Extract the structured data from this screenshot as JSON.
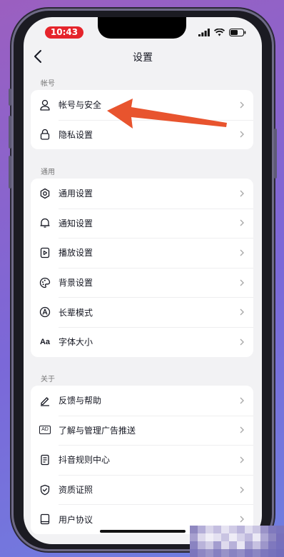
{
  "status_bar": {
    "time": "10:43"
  },
  "nav": {
    "title": "设置"
  },
  "sections": [
    {
      "header": "帐号",
      "items": [
        {
          "label": "帐号与安全",
          "icon": "person-icon"
        },
        {
          "label": "隐私设置",
          "icon": "lock-icon"
        }
      ]
    },
    {
      "header": "通用",
      "items": [
        {
          "label": "通用设置",
          "icon": "gear-icon"
        },
        {
          "label": "通知设置",
          "icon": "bell-icon"
        },
        {
          "label": "播放设置",
          "icon": "play-icon"
        },
        {
          "label": "背景设置",
          "icon": "palette-icon"
        },
        {
          "label": "长辈模式",
          "icon": "elder-mode-icon"
        },
        {
          "label": "字体大小",
          "icon": "font-size-icon",
          "icon_text": "Aa"
        }
      ]
    },
    {
      "header": "关于",
      "items": [
        {
          "label": "反馈与帮助",
          "icon": "pencil-icon"
        },
        {
          "label": "了解与管理广告推送",
          "icon": "ad-icon",
          "icon_text": "AD"
        },
        {
          "label": "抖音规则中心",
          "icon": "rules-icon"
        },
        {
          "label": "资质证照",
          "icon": "shield-check-icon"
        },
        {
          "label": "用户协议",
          "icon": "book-icon"
        }
      ]
    }
  ],
  "colors": {
    "accent_arrow": "#e8542e",
    "time_pill": "#e5242b"
  }
}
